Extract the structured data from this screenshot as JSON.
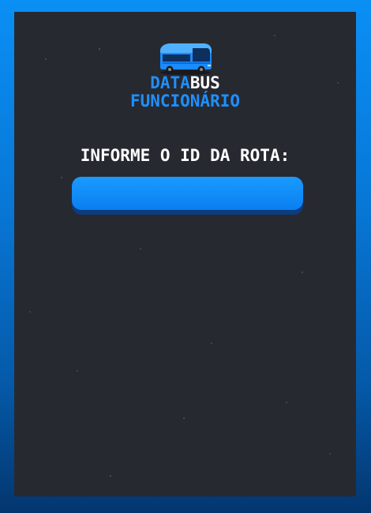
{
  "logo": {
    "title_part1": "DATA",
    "title_part2": "BUS",
    "subtitle": "FUNCIONÁRIO",
    "icon": "bus-icon"
  },
  "form": {
    "prompt": "INFORME O ID DA ROTA:",
    "route_id_value": "",
    "route_id_placeholder": ""
  },
  "colors": {
    "accent": "#1e90ff",
    "panel": "#272930",
    "input": "#0a7ff0",
    "frame_top": "#0a8ff5",
    "frame_bottom": "#03366f"
  }
}
